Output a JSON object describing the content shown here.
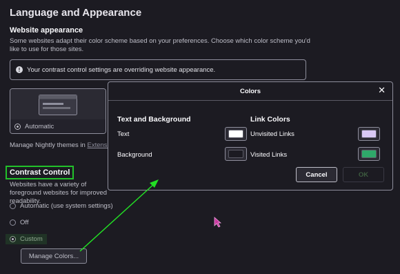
{
  "page": {
    "title": "Language and Appearance"
  },
  "website_appearance": {
    "title": "Website appearance",
    "description": "Some websites adapt their color scheme based on your preferences. Choose which color scheme you'd like to use for those sites.",
    "info_text": "Your contrast control settings are overriding website appearance.",
    "theme_option": "Automatic",
    "manage_themes_text": "Manage Nightly themes in ",
    "manage_themes_link": "Extensions"
  },
  "contrast_control": {
    "title": "Contrast Control",
    "description": "Websites have a variety of foreground websites for improved readability.",
    "options": {
      "automatic": "Automatic (use system settings)",
      "off": "Off",
      "custom": "Custom"
    },
    "selected": "Custom",
    "manage_colors_button": "Manage Colors..."
  },
  "colors_dialog": {
    "title": "Colors",
    "close_glyph": "✕",
    "text_bg_title": "Text and Background",
    "text_label": "Text",
    "background_label": "Background",
    "link_colors_title": "Link Colors",
    "unvisited_label": "Unvisited Links",
    "visited_label": "Visited Links",
    "cancel_label": "Cancel",
    "ok_label": "OK",
    "colors": {
      "text": "#ffffff",
      "background": "#1c1b22",
      "unvisited": "#d9c9f5",
      "visited": "#2fa86a"
    }
  },
  "annotation": {
    "highlight_color": "#22c22a",
    "arrow_color": "#22e024"
  },
  "icons": {
    "info": "info-icon",
    "close": "close-icon",
    "cursor": "mouse-cursor-icon"
  }
}
